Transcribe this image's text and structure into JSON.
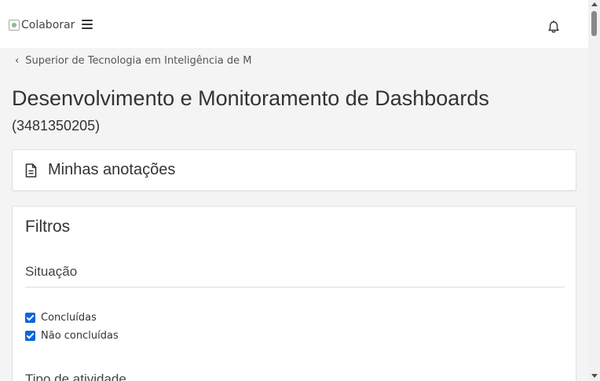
{
  "header": {
    "logo_alt": "Colaborar",
    "menu_icon": "hamburger-menu-icon",
    "notification_icon": "bell-icon"
  },
  "breadcrumb": {
    "back_icon": "chevron-left-icon",
    "label": "Superior de Tecnologia em Inteligência de M"
  },
  "course": {
    "title": "Desenvolvimento e Monitoramento de Dashboards",
    "code": "(3481350205)"
  },
  "notes": {
    "icon": "document-icon",
    "label": "Minhas anotações"
  },
  "filters": {
    "title": "Filtros",
    "situation": {
      "title": "Situação",
      "options": [
        {
          "label": "Concluídas",
          "checked": true
        },
        {
          "label": "Não concluídas",
          "checked": true
        }
      ]
    },
    "activity_type": {
      "title": "Tipo de atividade"
    }
  },
  "colors": {
    "checkbox_accent": "#0a66d8",
    "page_background": "#f4f4f4",
    "header_background": "#ffffff"
  }
}
